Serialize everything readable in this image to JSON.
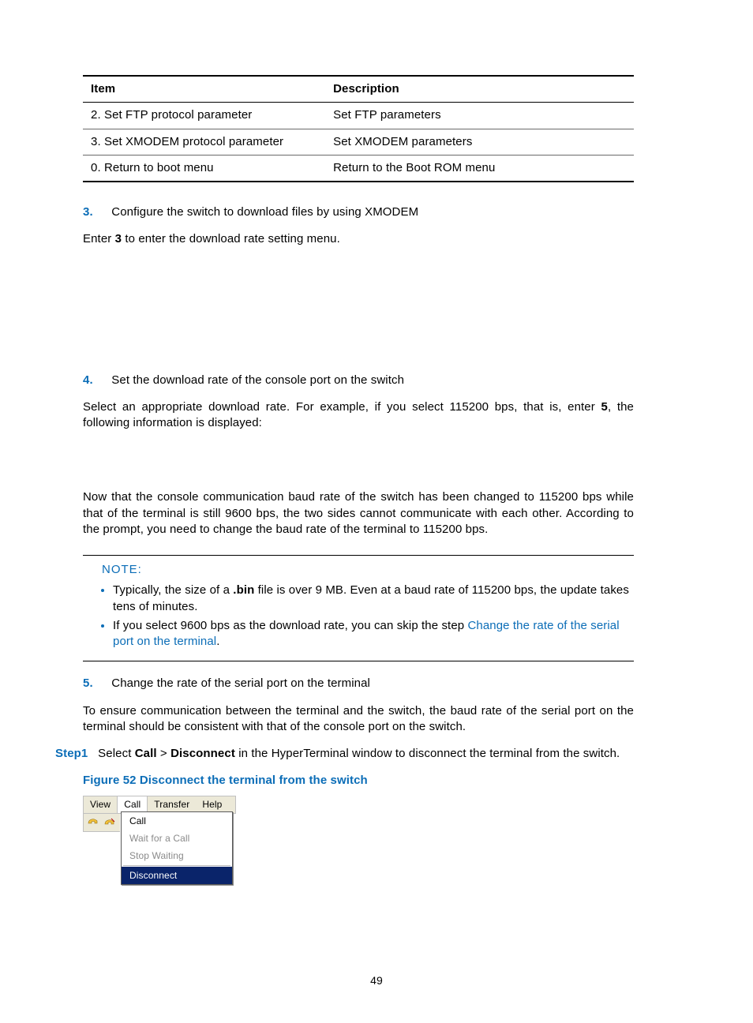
{
  "table": {
    "headers": {
      "col1": "Item",
      "col2": "Description"
    },
    "rows": [
      {
        "item": "2. Set FTP protocol parameter",
        "desc": "Set FTP parameters"
      },
      {
        "item": "3. Set XMODEM protocol parameter",
        "desc": "Set XMODEM parameters"
      },
      {
        "item": "0. Return to boot menu",
        "desc": "Return to the Boot ROM menu"
      }
    ]
  },
  "step3": {
    "num": "3.",
    "title": "Configure the switch to download files by using XMODEM",
    "p1_a": "Enter ",
    "p1_b": "3",
    "p1_c": " to enter the download rate setting menu."
  },
  "step4": {
    "num": "4.",
    "title": "Set the download rate of the console port on the switch",
    "p1_a": "Select an appropriate download rate. For example, if you select 115200 bps, that is, enter ",
    "p1_b": "5",
    "p1_c": ", the following information is displayed:",
    "p2": "Now that the console communication baud rate of the switch has been changed to 115200 bps while that of the terminal is still 9600 bps, the two sides cannot communicate with each other. According to the prompt, you need to change the baud rate of the terminal to 115200 bps."
  },
  "note": {
    "label": "NOTE:",
    "b1_a": "Typically, the size of a ",
    "b1_b": ".bin",
    "b1_c": " file is over 9 MB. Even at a baud rate of 115200 bps, the update takes tens of minutes.",
    "b2_a": "If you select 9600 bps as the download rate, you can skip the step ",
    "b2_link": "Change the rate of the serial port on the terminal",
    "b2_c": "."
  },
  "step5": {
    "num": "5.",
    "title": "Change the rate of the serial port on the terminal",
    "p1": "To ensure communication between the terminal and the switch, the baud rate of the serial port on the terminal should be consistent with that of the console port on the switch."
  },
  "step1line": {
    "label": "Step1",
    "t1": "Select ",
    "t2": "Call",
    "t3": " > ",
    "t4": "Disconnect",
    "t5": " in the HyperTerminal window to disconnect the terminal from the switch."
  },
  "figure": {
    "caption": "Figure 52 Disconnect the terminal from the switch",
    "menubar": {
      "view": "View",
      "call": "Call",
      "transfer": "Transfer",
      "help": "Help"
    },
    "dropdown": {
      "call": "Call",
      "wait": "Wait for a Call",
      "stop": "Stop Waiting",
      "disconnect": "Disconnect"
    }
  },
  "pagenum": "49"
}
